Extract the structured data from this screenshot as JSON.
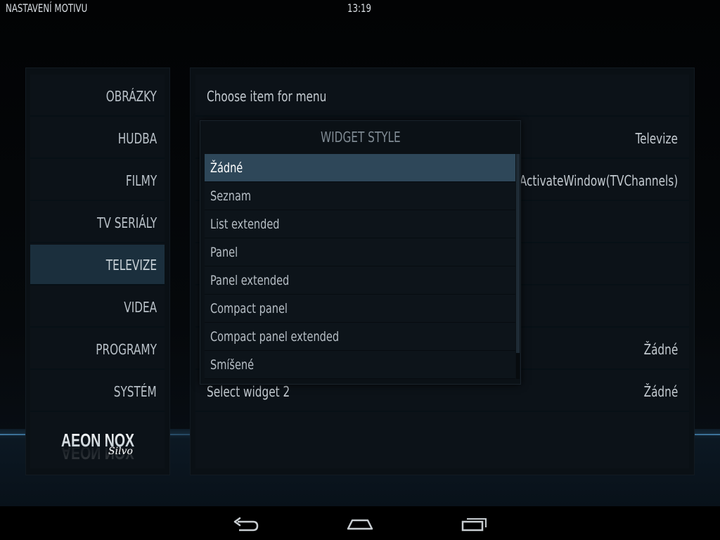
{
  "header": {
    "title": "NASTAVENÍ MOTIVU",
    "clock": "13:19"
  },
  "menu": {
    "items": [
      {
        "label": "OBRÁZKY"
      },
      {
        "label": "HUDBA"
      },
      {
        "label": "FILMY"
      },
      {
        "label": "TV SERIÁLY"
      },
      {
        "label": "TELEVIZE"
      },
      {
        "label": "VIDEA"
      },
      {
        "label": "PROGRAMY"
      },
      {
        "label": "SYSTÉM"
      }
    ],
    "active_item": "TELEVIZE",
    "logo_text": "AEON NOX",
    "logo_subtext": "Silvo"
  },
  "settings": {
    "rows": [
      {
        "label": "Choose item for menu",
        "value": ""
      },
      {
        "label": "",
        "value": "Televize"
      },
      {
        "label": "",
        "value": "ActivateWindow(TVChannels)"
      },
      {
        "label": "",
        "value": ""
      },
      {
        "label": "",
        "value": ""
      },
      {
        "label": "",
        "value": "Žádné"
      },
      {
        "label": "Select widget 2",
        "value": "Žádné"
      }
    ]
  },
  "dialog": {
    "title": "WIDGET STYLE",
    "options": [
      {
        "label": "Žádné"
      },
      {
        "label": "Seznam"
      },
      {
        "label": "List extended"
      },
      {
        "label": "Panel"
      },
      {
        "label": "Panel extended"
      },
      {
        "label": "Compact panel"
      },
      {
        "label": "Compact panel extended"
      },
      {
        "label": "Smíšené"
      }
    ],
    "selected": "Žádné"
  },
  "navbar": {
    "icons": [
      "back-icon",
      "home-icon",
      "recent-apps-icon"
    ]
  }
}
